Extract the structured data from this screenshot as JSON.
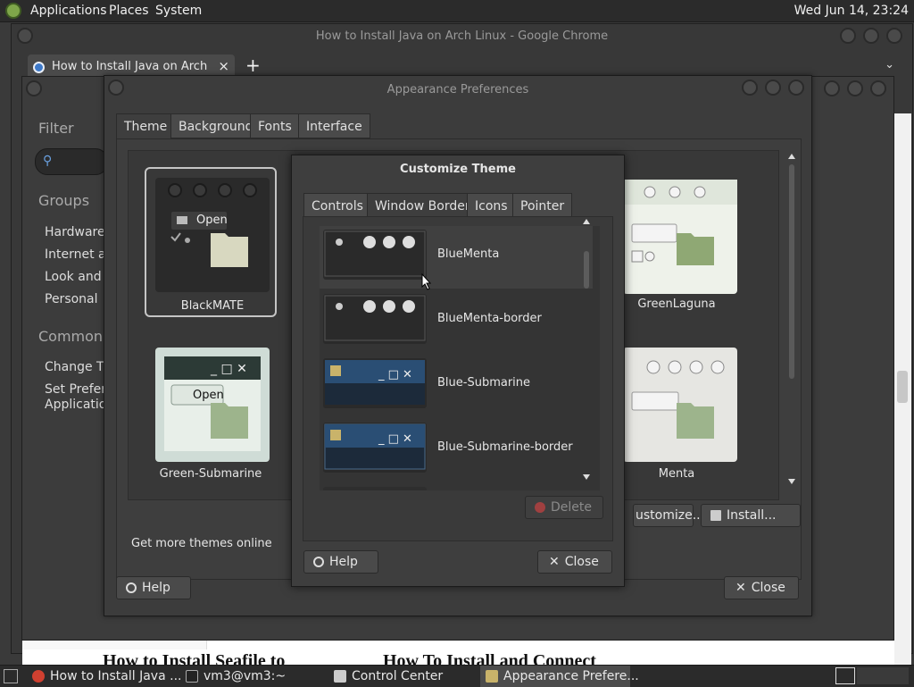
{
  "top_panel": {
    "menus": [
      "Applications",
      "Places",
      "System"
    ],
    "clock": "Wed Jun 14, 23:24"
  },
  "chrome": {
    "window_title": "How to Install Java on Arch Linux - Google Chrome",
    "tab_title": "How to Install Java on Arch Lin",
    "new_tab": "+",
    "close_tab": "×",
    "page_headlines": [
      "How to Install Seafile to",
      "How To Install and Connect"
    ]
  },
  "control_center": {
    "filter": "Filter",
    "groups_heading": "Groups",
    "groups": [
      "Hardware",
      "Internet an",
      "Look and F",
      "Personal"
    ],
    "common_heading": "Common T",
    "common_items": [
      "Change Th",
      "Set Preferre",
      "Application"
    ]
  },
  "appearance": {
    "title": "Appearance Preferences",
    "tabs": [
      "Theme",
      "Background",
      "Fonts",
      "Interface"
    ],
    "themes": [
      {
        "name": "BlackMATE",
        "selected": true
      },
      {
        "name": "GreenLaguna"
      },
      {
        "name": "Green-Submarine"
      },
      {
        "name": "Menta"
      }
    ],
    "thumb_open": "Open",
    "get_more": "Get more themes online",
    "customize_button": "ustomize...",
    "install_button": "Install...",
    "help_button": "Help",
    "close_button": "Close"
  },
  "customize": {
    "title": "Customize Theme",
    "tabs": [
      "Controls",
      "Window Border",
      "Icons",
      "Pointer"
    ],
    "active_tab": "Window Border",
    "borders": [
      "BlueMenta",
      "BlueMenta-border",
      "Blue-Submarine",
      "Blue-Submarine-border"
    ],
    "delete_button": "Delete",
    "help_button": "Help",
    "close_button": "Close"
  },
  "taskbar": {
    "tasks": [
      "How to Install Java ...",
      "vm3@vm3:~",
      "Control Center",
      "Appearance Prefere..."
    ]
  },
  "colors": {
    "panel": "#2b2b2b",
    "window": "#3c3c3c",
    "accent_green": "#7fa64a"
  }
}
